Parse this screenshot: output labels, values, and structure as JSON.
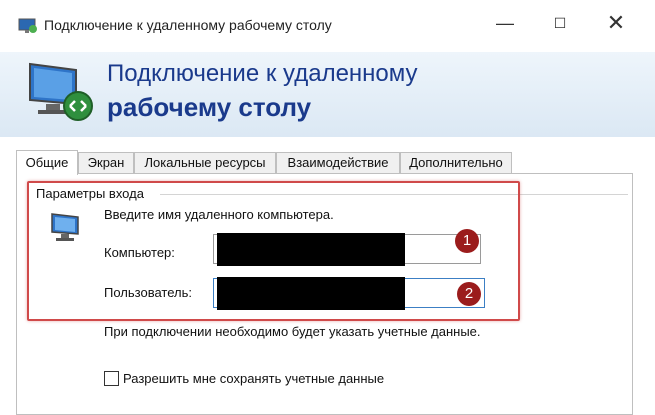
{
  "window": {
    "title": "Подключение к удаленному рабочему столу",
    "minimize_glyph": "—",
    "maximize_glyph": "☐",
    "close_glyph": "✕"
  },
  "banner": {
    "line1": "Подключение к удаленному",
    "line2": "рабочему столу"
  },
  "tabs": [
    {
      "label": "Общие",
      "active": true
    },
    {
      "label": "Экран"
    },
    {
      "label": "Локальные ресурсы"
    },
    {
      "label": "Взаимодействие"
    },
    {
      "label": "Дополнительно"
    }
  ],
  "login_group": {
    "title": "Параметры входа",
    "instruction": "Введите имя удаленного компьютера.",
    "computer_label": "Компьютер:",
    "computer_value": "",
    "user_label": "Пользователь:",
    "user_value": "",
    "note": "При подключении необходимо будет указать учетные данные.",
    "save_credentials_label": "Разрешить мне сохранять учетные данные",
    "save_credentials_checked": false
  },
  "annotations": {
    "badge1": "1",
    "badge2": "2",
    "highlight_color": "#d04a4a",
    "badge_color": "#9b1c1c"
  },
  "icons": [
    "remote-desktop-icon",
    "computer-icon"
  ],
  "colors": {
    "accent_text": "#1a3a8c",
    "banner_top": "#eef5fb",
    "banner_bottom": "#dbe8f4"
  }
}
